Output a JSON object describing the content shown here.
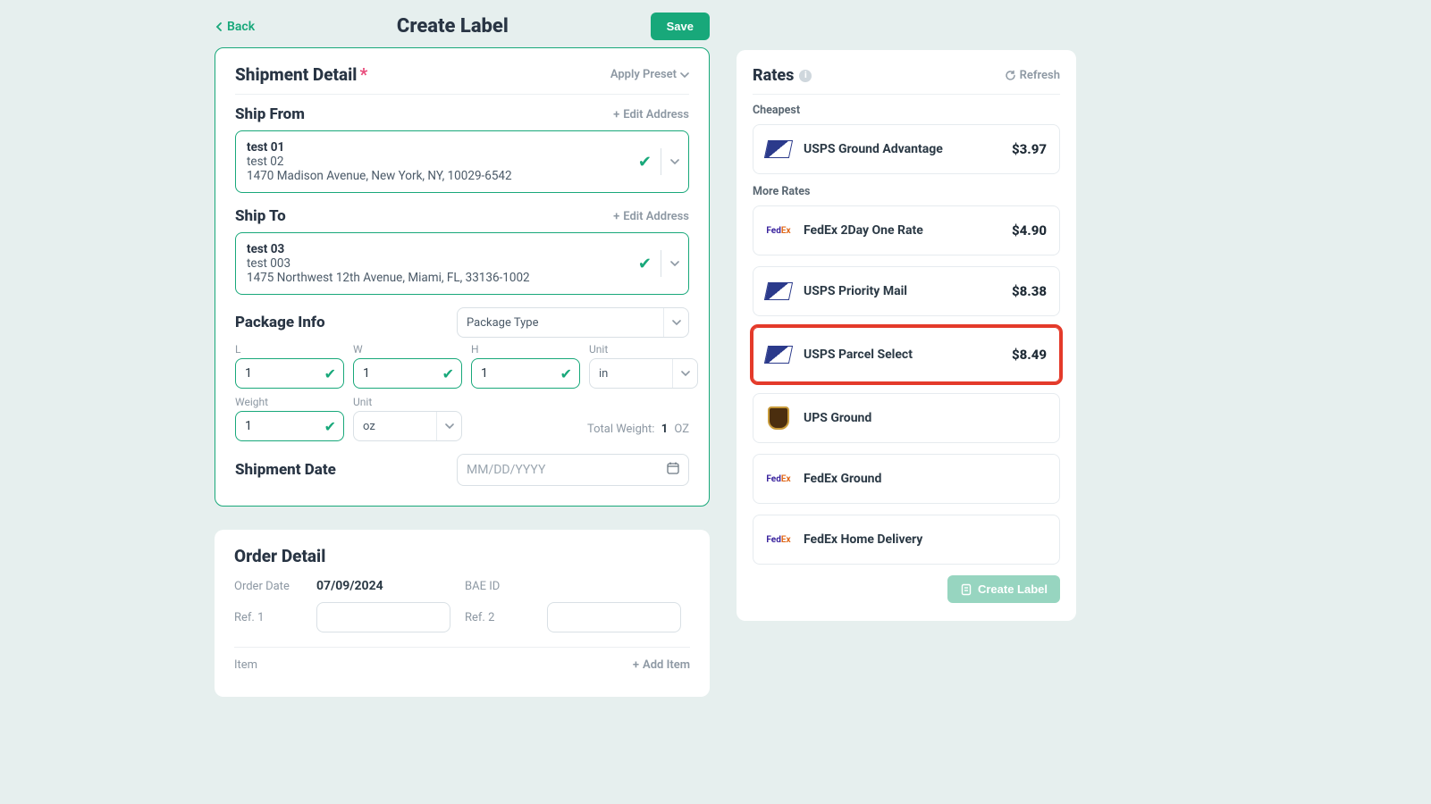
{
  "header": {
    "back": "Back",
    "title": "Create Label",
    "save": "Save"
  },
  "shipment": {
    "title": "Shipment Detail",
    "apply_preset": "Apply Preset",
    "ship_from": {
      "title": "Ship From",
      "edit": "Edit Address",
      "name": "test 01",
      "line2": "test 02",
      "addr": "1470 Madison Avenue, New York, NY, 10029-6542"
    },
    "ship_to": {
      "title": "Ship To",
      "edit": "Edit Address",
      "name": "test 03",
      "line2": "test 003",
      "addr": "1475 Northwest 12th Avenue, Miami, FL, 33136-1002"
    },
    "pkg": {
      "title": "Package Info",
      "package_type": "Package Type",
      "labels": {
        "L": "L",
        "W": "W",
        "H": "H",
        "Unit": "Unit",
        "Weight": "Weight",
        "Unit2": "Unit"
      },
      "L": "1",
      "W": "1",
      "H": "1",
      "dim_unit": "in",
      "weight": "1",
      "wt_unit": "oz",
      "total_label": "Total Weight:",
      "total_val": "1",
      "total_unit": "OZ"
    },
    "ship_date": {
      "title": "Shipment Date",
      "placeholder": "MM/DD/YYYY"
    }
  },
  "order": {
    "title": "Order Detail",
    "order_date_label": "Order Date",
    "order_date": "07/09/2024",
    "bae_label": "BAE ID",
    "ref1_label": "Ref. 1",
    "ref2_label": "Ref. 2",
    "item_label": "Item",
    "add_item": "Add Item"
  },
  "rates": {
    "title": "Rates",
    "refresh": "Refresh",
    "cheapest_label": "Cheapest",
    "more_label": "More Rates",
    "cheapest": {
      "carrier": "usps",
      "name": "USPS Ground Advantage",
      "price": "$3.97"
    },
    "items": [
      {
        "carrier": "fedex",
        "name": "FedEx 2Day One Rate",
        "price": "$4.90"
      },
      {
        "carrier": "usps",
        "name": "USPS Priority Mail",
        "price": "$8.38"
      },
      {
        "carrier": "usps",
        "name": "USPS Parcel Select",
        "price": "$8.49",
        "highlight": true
      },
      {
        "carrier": "ups",
        "name": "UPS Ground",
        "price": ""
      },
      {
        "carrier": "fedex",
        "name": "FedEx Ground",
        "price": ""
      },
      {
        "carrier": "fedex",
        "name": "FedEx Home Delivery",
        "price": ""
      }
    ],
    "create_btn": "Create Label"
  }
}
